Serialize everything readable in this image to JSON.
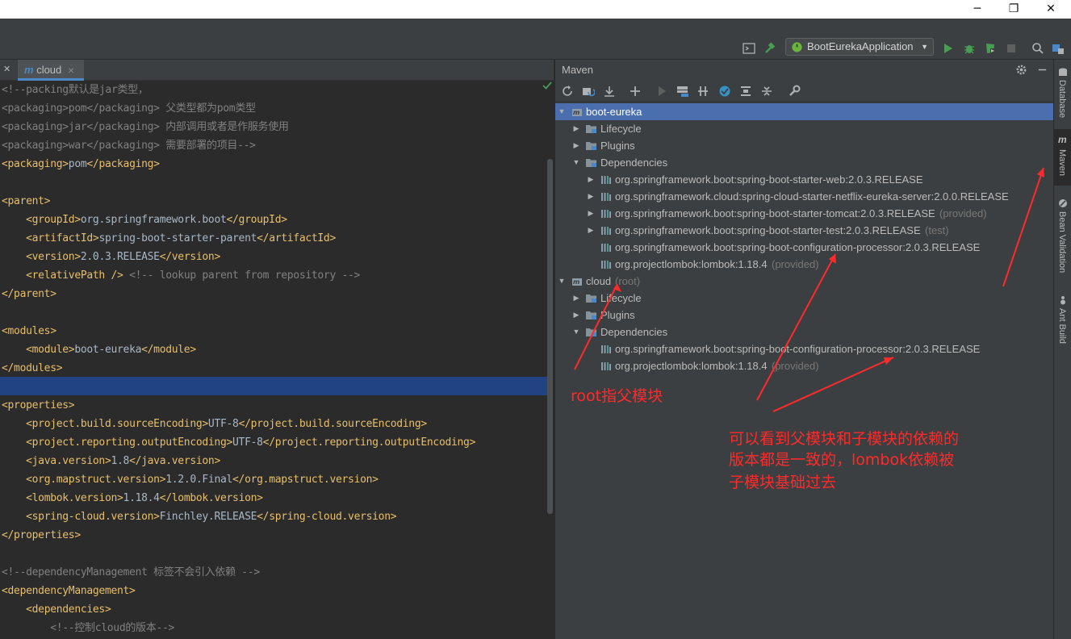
{
  "window": {
    "minimize": "─",
    "restore": "❐",
    "close": "✕"
  },
  "toolbar": {
    "run_config": "BootEurekaApplication"
  },
  "editor": {
    "tab_icon": "m",
    "tab_label": "cloud",
    "lines": [
      [
        [
          "cmt",
          "<!--packing默认是jar类型，"
        ]
      ],
      [
        [
          "cmt",
          "<packaging>"
        ],
        [
          "cmt",
          "pom"
        ],
        [
          "cmt",
          "</packaging> 父类型都为pom类型"
        ]
      ],
      [
        [
          "cmt",
          "<packaging>jar</packaging> 内部调用或者是作服务使用"
        ]
      ],
      [
        [
          "cmt",
          "<packaging>war</packaging> 需要部署的项目-->"
        ]
      ],
      [
        [
          "tag",
          "<packaging>"
        ],
        [
          "txt",
          "pom"
        ],
        [
          "tag",
          "</packaging>"
        ]
      ],
      [],
      [
        [
          "tag",
          "<parent>"
        ]
      ],
      [
        [
          "txt",
          "    "
        ],
        [
          "tag",
          "<groupId>"
        ],
        [
          "txt",
          "org.springframework.boot"
        ],
        [
          "tag",
          "</groupId>"
        ]
      ],
      [
        [
          "txt",
          "    "
        ],
        [
          "tag",
          "<artifactId>"
        ],
        [
          "txt",
          "spring-boot-starter-parent"
        ],
        [
          "tag",
          "</artifactId>"
        ]
      ],
      [
        [
          "txt",
          "    "
        ],
        [
          "tag",
          "<version>"
        ],
        [
          "txt",
          "2.0.3.RELEASE"
        ],
        [
          "tag",
          "</version>"
        ]
      ],
      [
        [
          "txt",
          "    "
        ],
        [
          "tag",
          "<relativePath />"
        ],
        [
          "cmt",
          " <!-- lookup parent from repository -->"
        ]
      ],
      [
        [
          "tag",
          "</parent>"
        ]
      ],
      [],
      [
        [
          "tag",
          "<modules>"
        ]
      ],
      [
        [
          "txt",
          "    "
        ],
        [
          "tag",
          "<module>"
        ],
        [
          "txt",
          "boot-eureka"
        ],
        [
          "tag",
          "</module>"
        ]
      ],
      [
        [
          "tag",
          "</modules>"
        ]
      ],
      [],
      [
        [
          "tag",
          "<properties>"
        ]
      ],
      [
        [
          "txt",
          "    "
        ],
        [
          "tag",
          "<project.build.sourceEncoding>"
        ],
        [
          "txt",
          "UTF-8"
        ],
        [
          "tag",
          "</project.build.sourceEncoding>"
        ]
      ],
      [
        [
          "txt",
          "    "
        ],
        [
          "tag",
          "<project.reporting.outputEncoding>"
        ],
        [
          "txt",
          "UTF-8"
        ],
        [
          "tag",
          "</project.reporting.outputEncoding>"
        ]
      ],
      [
        [
          "txt",
          "    "
        ],
        [
          "tag",
          "<java.version>"
        ],
        [
          "txt",
          "1.8"
        ],
        [
          "tag",
          "</java.version>"
        ]
      ],
      [
        [
          "txt",
          "    "
        ],
        [
          "tag",
          "<org.mapstruct.version>"
        ],
        [
          "txt",
          "1.2.0.Final"
        ],
        [
          "tag",
          "</org.mapstruct.version>"
        ]
      ],
      [
        [
          "txt",
          "    "
        ],
        [
          "tag",
          "<lombok.version>"
        ],
        [
          "txt",
          "1.18.4"
        ],
        [
          "tag",
          "</lombok.version>"
        ]
      ],
      [
        [
          "txt",
          "    "
        ],
        [
          "tag",
          "<spring-cloud.version>"
        ],
        [
          "txt",
          "Finchley.RELEASE"
        ],
        [
          "tag",
          "</spring-cloud.version>"
        ]
      ],
      [
        [
          "tag",
          "</properties>"
        ]
      ],
      [],
      [
        [
          "cmt",
          "<!--dependencyManagement 标签不会引入依赖 -->"
        ]
      ],
      [
        [
          "tag",
          "<dependencyManagement>"
        ]
      ],
      [
        [
          "txt",
          "    "
        ],
        [
          "tag",
          "<dependencies>"
        ]
      ],
      [
        [
          "txt",
          "        "
        ],
        [
          "cmt",
          "<!--控制cloud的版本-->"
        ]
      ]
    ]
  },
  "maven": {
    "title": "Maven",
    "tree": [
      {
        "level": 0,
        "expanded": true,
        "icon": "module",
        "label": "boot-eureka",
        "suffix": "",
        "selected": true
      },
      {
        "level": 1,
        "expanded": false,
        "icon": "folder",
        "label": "Lifecycle",
        "suffix": ""
      },
      {
        "level": 1,
        "expanded": false,
        "icon": "folder",
        "label": "Plugins",
        "suffix": ""
      },
      {
        "level": 1,
        "expanded": true,
        "icon": "folder",
        "label": "Dependencies",
        "suffix": ""
      },
      {
        "level": 2,
        "expanded": false,
        "icon": "lib",
        "label": "org.springframework.boot:spring-boot-starter-web:2.0.3.RELEASE",
        "suffix": ""
      },
      {
        "level": 2,
        "expanded": false,
        "icon": "lib",
        "label": "org.springframework.cloud:spring-cloud-starter-netflix-eureka-server:2.0.0.RELEASE",
        "suffix": ""
      },
      {
        "level": 2,
        "expanded": false,
        "icon": "lib",
        "label": "org.springframework.boot:spring-boot-starter-tomcat:2.0.3.RELEASE",
        "suffix": "(provided)"
      },
      {
        "level": 2,
        "expanded": false,
        "icon": "lib",
        "label": "org.springframework.boot:spring-boot-starter-test:2.0.3.RELEASE",
        "suffix": "(test)"
      },
      {
        "level": 2,
        "leaf": true,
        "icon": "lib",
        "label": "org.springframework.boot:spring-boot-configuration-processor:2.0.3.RELEASE",
        "suffix": ""
      },
      {
        "level": 2,
        "leaf": true,
        "icon": "lib",
        "label": "org.projectlombok:lombok:1.18.4",
        "suffix": "(provided)"
      },
      {
        "level": 0,
        "expanded": true,
        "icon": "module",
        "label": "cloud",
        "suffix": "(root)"
      },
      {
        "level": 1,
        "expanded": false,
        "icon": "folder",
        "label": "Lifecycle",
        "suffix": ""
      },
      {
        "level": 1,
        "expanded": false,
        "icon": "folder",
        "label": "Plugins",
        "suffix": ""
      },
      {
        "level": 1,
        "expanded": true,
        "icon": "folder",
        "label": "Dependencies",
        "suffix": ""
      },
      {
        "level": 2,
        "leaf": true,
        "icon": "lib",
        "label": "org.springframework.boot:spring-boot-configuration-processor:2.0.3.RELEASE",
        "suffix": ""
      },
      {
        "level": 2,
        "leaf": true,
        "icon": "lib",
        "label": "org.projectlombok:lombok:1.18.4",
        "suffix": "(provided)"
      }
    ]
  },
  "side_tabs": {
    "database": "Database",
    "maven_icon": "m",
    "maven": "Maven",
    "bean": "Bean Validation",
    "ant": "Ant Build"
  },
  "annotations": {
    "root_note": "root指父模块",
    "version_note_1": "可以看到父模块和子模块的依赖的",
    "version_note_2": "版本都是一致的，lombok依赖被",
    "version_note_3": "子模块基础过去"
  },
  "colors": {
    "accent": "#4a88c7",
    "selection": "#4b6eaf",
    "annotation": "#ff2a2a",
    "run_green": "#499c54"
  }
}
